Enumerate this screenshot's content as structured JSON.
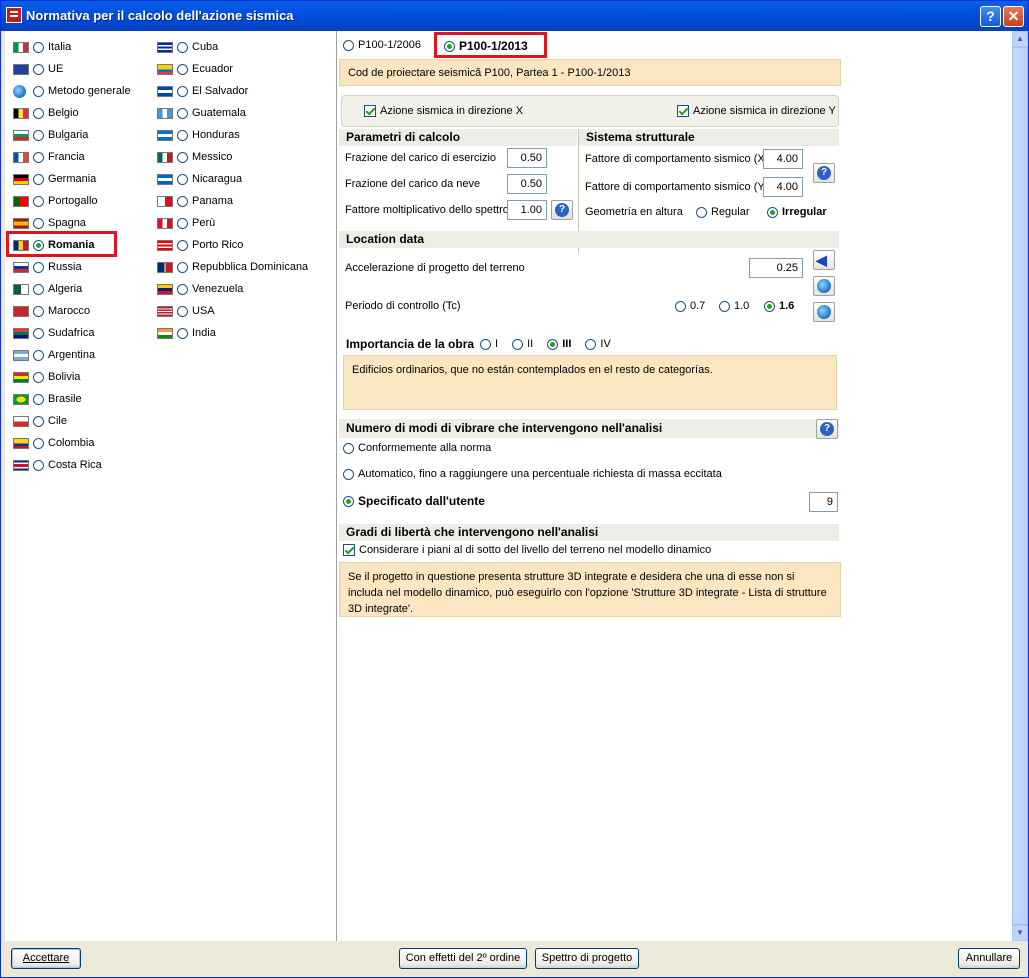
{
  "window": {
    "title": "Normativa per il calcolo dell'azione sismica",
    "help_glyph": "?",
    "close_glyph": "✕"
  },
  "countries_col1": [
    {
      "name": "Italia",
      "flag": "it",
      "selected": false
    },
    {
      "name": "UE",
      "flag": "eu",
      "selected": false
    },
    {
      "name": "Metodo generale",
      "flag": "globe",
      "selected": false
    },
    {
      "name": "Belgio",
      "flag": "be",
      "selected": false
    },
    {
      "name": "Bulgaria",
      "flag": "bg",
      "selected": false
    },
    {
      "name": "Francia",
      "flag": "fr",
      "selected": false
    },
    {
      "name": "Germania",
      "flag": "de",
      "selected": false
    },
    {
      "name": "Portogallo",
      "flag": "pt",
      "selected": false
    },
    {
      "name": "Spagna",
      "flag": "es",
      "selected": false
    },
    {
      "name": "Romania",
      "flag": "ro",
      "selected": true
    },
    {
      "name": "Russia",
      "flag": "ru",
      "selected": false
    },
    {
      "name": "Algeria",
      "flag": "dz",
      "selected": false
    },
    {
      "name": "Marocco",
      "flag": "ma",
      "selected": false
    },
    {
      "name": "Sudafrica",
      "flag": "za",
      "selected": false
    },
    {
      "name": "Argentina",
      "flag": "ar",
      "selected": false
    },
    {
      "name": "Bolivia",
      "flag": "bo",
      "selected": false
    },
    {
      "name": "Brasile",
      "flag": "br",
      "selected": false
    },
    {
      "name": "Cile",
      "flag": "cl",
      "selected": false
    },
    {
      "name": "Colombia",
      "flag": "co",
      "selected": false
    },
    {
      "name": "Costa Rica",
      "flag": "cr",
      "selected": false
    }
  ],
  "countries_col2": [
    {
      "name": "Cuba",
      "flag": "cu",
      "selected": false
    },
    {
      "name": "Ecuador",
      "flag": "ec",
      "selected": false
    },
    {
      "name": "El Salvador",
      "flag": "sv",
      "selected": false
    },
    {
      "name": "Guatemala",
      "flag": "gt",
      "selected": false
    },
    {
      "name": "Honduras",
      "flag": "hn",
      "selected": false
    },
    {
      "name": "Messico",
      "flag": "mx",
      "selected": false
    },
    {
      "name": "Nicaragua",
      "flag": "ni",
      "selected": false
    },
    {
      "name": "Panama",
      "flag": "pa",
      "selected": false
    },
    {
      "name": "Perù",
      "flag": "pe",
      "selected": false
    },
    {
      "name": "Porto Rico",
      "flag": "pr",
      "selected": false
    },
    {
      "name": "Repubblica Dominicana",
      "flag": "do",
      "selected": false
    },
    {
      "name": "Venezuela",
      "flag": "ve",
      "selected": false
    },
    {
      "name": "USA",
      "flag": "us",
      "selected": false
    },
    {
      "name": "India",
      "flag": "in",
      "selected": false
    }
  ],
  "norm": {
    "opt1": "P100-1/2006",
    "opt2": "P100-1/2013",
    "description": "Cod de proiectare seismică P100, Partea 1 - P100-1/2013"
  },
  "directions": {
    "x_label": "Azione sismica in direzione X",
    "y_label": "Azione sismica in direzione Y"
  },
  "parametri": {
    "header": "Parametri di calcolo",
    "esercizio_label": "Frazione del carico di esercizio",
    "esercizio_value": "0.50",
    "neve_label": "Frazione del carico da neve",
    "neve_value": "0.50",
    "spettro_label": "Fattore moltiplicativo dello spettro",
    "spettro_value": "1.00"
  },
  "sistema": {
    "header": "Sistema strutturale",
    "fx_label": "Fattore di comportamento sismico (X)",
    "fx_value": "4.00",
    "fy_label": "Fattore di comportamento sismico (Y)",
    "fy_value": "4.00",
    "geom_label": "Geometría en altura",
    "geom_opt1": "Regular",
    "geom_opt2": "Irregular"
  },
  "location": {
    "header": "Location data",
    "acc_label": "Accelerazione di progetto del terreno",
    "acc_value": "0.25",
    "tc_label": "Periodo di controllo (Tc)",
    "tc_opt1": "0.7",
    "tc_opt2": "1.0",
    "tc_opt3": "1.6"
  },
  "importanza": {
    "header": "Importancia de la obra",
    "opt1": "I",
    "opt2": "II",
    "opt3": "III",
    "opt4": "IV",
    "description": "Edificios ordinarios, que no están contemplados en el resto de categorías."
  },
  "modi": {
    "header": "Numero di modi di vibrare che intervengono nell'analisi",
    "opt1": "Conformemente alla norma",
    "opt2": "Automatico, fino a raggiungere una percentuale richiesta di massa eccitata",
    "opt3": "Specificato dall'utente",
    "value": "9"
  },
  "gradi": {
    "header": "Gradi di libertà che intervengono nell'analisi",
    "check_label": "Considerare i piani al di sotto del livello del terreno nel modello dinamico",
    "note": "Se il progetto in questione presenta strutture 3D integrate e desidera che una di esse non si includa nel modello dinamico, può eseguirlo con l'opzione 'Strutture 3D integrate - Lista di strutture 3D integrate'."
  },
  "buttons": {
    "accept": "Accettare",
    "second_order": "Con effetti del 2º ordine",
    "spectrum": "Spettro di progetto",
    "cancel": "Annullare"
  }
}
